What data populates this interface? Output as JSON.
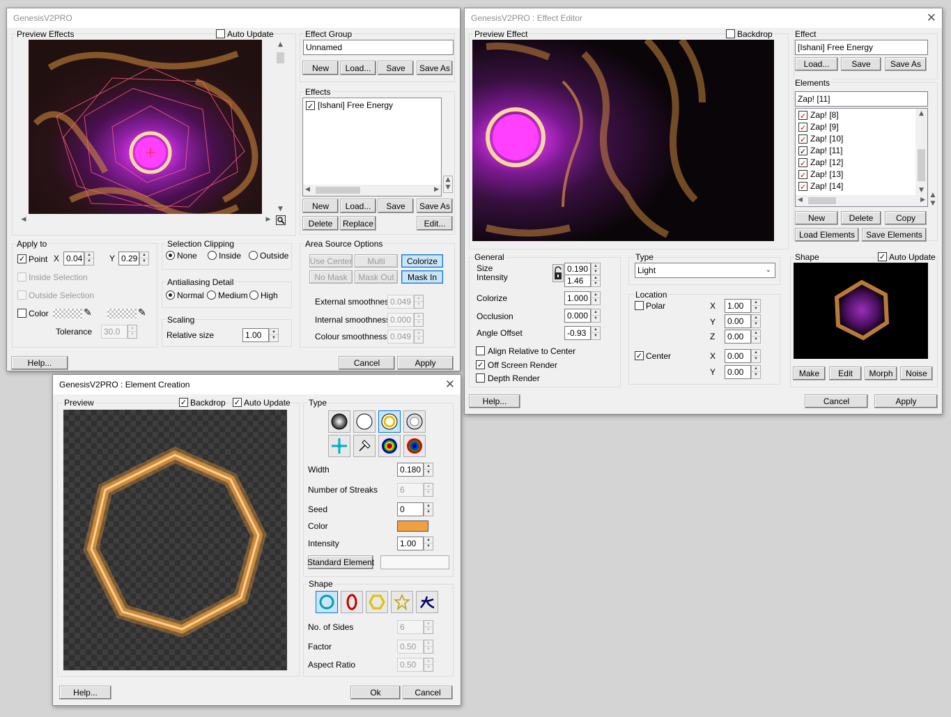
{
  "main_window": {
    "title": "GenesisV2PRO",
    "preview_label": "Preview Effects",
    "auto_update_label": "Auto Update",
    "effect_group": {
      "label": "Effect Group",
      "name": "Unnamed",
      "buttons": [
        "New",
        "Load...",
        "Save",
        "Save As"
      ]
    },
    "effects": {
      "label": "Effects",
      "items": [
        "[Ishani] Free Energy"
      ],
      "buttons": [
        "New",
        "Load...",
        "Save",
        "Save As"
      ],
      "buttons2": [
        "Delete",
        "Replace",
        "Edit..."
      ]
    },
    "apply_to": {
      "label": "Apply to",
      "point_label": "Point",
      "x_label": "X",
      "x_value": "0.04",
      "y_label": "Y",
      "y_value": "0.29",
      "inside_selection": "Inside Selection",
      "outside_selection": "Outside Selection",
      "color_label": "Color",
      "tolerance_label": "Tolerance",
      "tolerance_value": "30.0"
    },
    "selection_clipping": {
      "label": "Selection Clipping",
      "options": [
        "None",
        "Inside",
        "Outside"
      ],
      "selected": "None"
    },
    "antialiasing": {
      "label": "Antialiasing Detail",
      "options": [
        "Normal",
        "Medium",
        "High"
      ],
      "selected": "Normal"
    },
    "scaling": {
      "label": "Scaling",
      "relative_size_label": "Relative size",
      "relative_size_value": "1.00"
    },
    "area_source": {
      "label": "Area Source Options",
      "buttons_row1": [
        "Use Center",
        "Multi",
        "Colorize"
      ],
      "buttons_row2": [
        "No Mask",
        "Mask Out",
        "Mask In"
      ],
      "external_label": "External smoothness",
      "external_value": "0.049",
      "internal_label": "Internal smoothness",
      "internal_value": "0.000",
      "colour_label": "Colour smoothness",
      "colour_value": "0.049"
    },
    "help_button": "Help...",
    "cancel_button": "Cancel",
    "apply_button": "Apply"
  },
  "effect_editor": {
    "title": "GenesisV2PRO : Effect Editor",
    "preview_label": "Preview Effect",
    "backdrop_label": "Backdrop",
    "effect": {
      "label": "Effect",
      "name": "[Ishani] Free Energy",
      "buttons": [
        "Load...",
        "Save",
        "Save As"
      ]
    },
    "elements": {
      "label": "Elements",
      "current": "Zap! [11]",
      "items": [
        "Zap! [8]",
        "Zap! [9]",
        "Zap! [10]",
        "Zap! [11]",
        "Zap! [12]",
        "Zap! [13]",
        "Zap! [14]"
      ],
      "buttons": [
        "New",
        "Delete",
        "Copy"
      ],
      "load_elements": "Load Elements",
      "save_elements": "Save Elements"
    },
    "general": {
      "label": "General",
      "size_label": "Size",
      "size_value": "0.190",
      "intensity_label": "Intensity",
      "intensity_value": "1.46",
      "colorize_label": "Colorize",
      "colorize_value": "1.000",
      "occlusion_label": "Occlusion",
      "occlusion_value": "0.000",
      "angle_offset_label": "Angle Offset",
      "angle_offset_value": "-0.93",
      "align_label": "Align Relative to Center",
      "offscreen_label": "Off Screen Render",
      "depth_label": "Depth Render"
    },
    "type": {
      "label": "Type",
      "value": "Light"
    },
    "location": {
      "label": "Location",
      "polar_label": "Polar",
      "center_label": "Center",
      "x1_label": "X",
      "x1_value": "1.00",
      "y1_label": "Y",
      "y1_value": "0.00",
      "z1_label": "Z",
      "z1_value": "0.00",
      "x2_label": "X",
      "x2_value": "0.00",
      "y2_label": "Y",
      "y2_value": "0.00"
    },
    "shape": {
      "label": "Shape",
      "auto_update_label": "Auto Update",
      "buttons": [
        "Make",
        "Edit",
        "Morph",
        "Noise"
      ]
    },
    "help_button": "Help...",
    "cancel_button": "Cancel",
    "apply_button": "Apply"
  },
  "element_creation": {
    "title": "GenesisV2PRO : Element Creation",
    "preview_label": "Preview",
    "backdrop_label": "Backdrop",
    "auto_update_label": "Auto Update",
    "type_label": "Type",
    "width_label": "Width",
    "width_value": "0.180",
    "streaks_label": "Number of Streaks",
    "streaks_value": "6",
    "seed_label": "Seed",
    "seed_value": "0",
    "color_label": "Color",
    "color_value": "#f0a040",
    "intensity_label": "Intensity",
    "intensity_value": "1.00",
    "standard_element_button": "Standard Element",
    "shape_label": "Shape",
    "sides_label": "No. of Sides",
    "sides_value": "6",
    "factor_label": "Factor",
    "factor_value": "0.50",
    "aspect_label": "Aspect Ratio",
    "aspect_value": "0.50",
    "help_button": "Help...",
    "ok_button": "Ok",
    "cancel_button": "Cancel"
  },
  "colors": {
    "accent_blue": "#0078d7",
    "flame_orange": "#f0a040",
    "energy_purple": "#c020e0"
  }
}
